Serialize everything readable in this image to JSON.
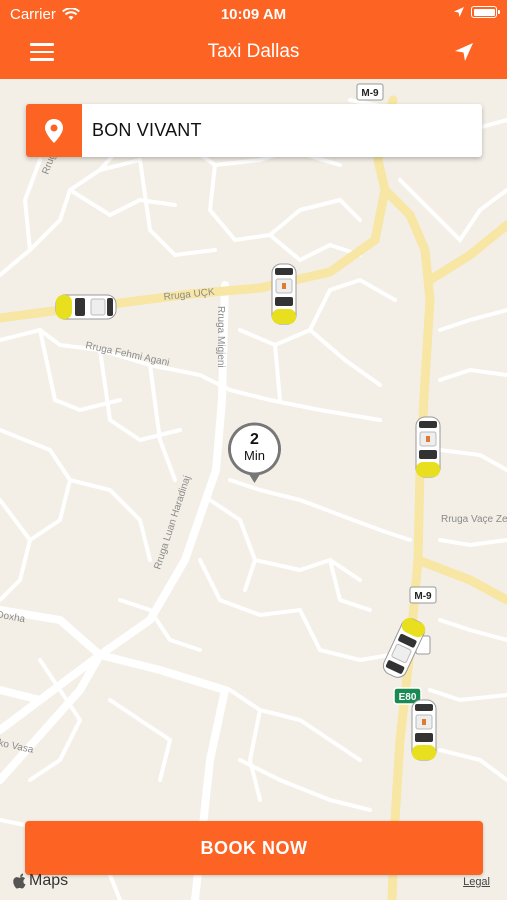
{
  "status_bar": {
    "carrier": "Carrier",
    "time": "10:09 AM"
  },
  "header": {
    "title": "Taxi Dallas",
    "menu_icon": "hamburger-menu-icon",
    "locate_icon": "location-arrow-icon",
    "background": "#fd6322"
  },
  "search": {
    "value": "BON VIVANT",
    "icon": "map-pin-icon"
  },
  "eta_marker": {
    "value": "2",
    "unit": "Min"
  },
  "map": {
    "road_labels": [
      "Rruga UÇK",
      "Rruga Fehmi Agani",
      "Rruga Migjeni",
      "Rruga Luan Haradinaj",
      "Rruga Vaçe Zela",
      "Doxha",
      "ko Vasa"
    ],
    "road_badges": [
      "M-9",
      "M-9",
      "E80"
    ]
  },
  "cars_count_visible": 6,
  "book_button": {
    "label": "BOOK NOW"
  },
  "attribution": {
    "maps": "Maps",
    "legal": "Legal"
  },
  "colors": {
    "accent": "#fd6322",
    "map_bg": "#f3efe6",
    "highway": "#f7e7a8",
    "taxi_yellow": "#e8e01f"
  }
}
